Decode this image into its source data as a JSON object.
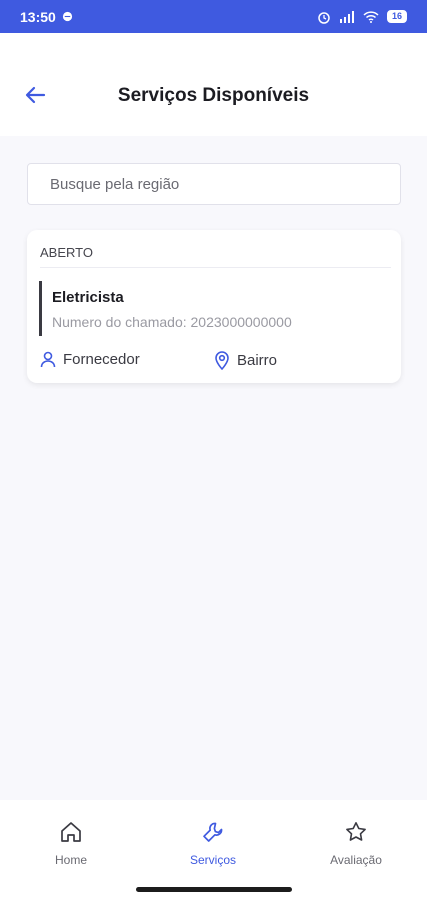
{
  "statusbar": {
    "time": "13:50",
    "battery": "16"
  },
  "header": {
    "title": "Serviços Disponíveis"
  },
  "search": {
    "placeholder": "Busque pela região"
  },
  "card": {
    "status": "ABERTO",
    "service": "Eletricista",
    "number": "Numero do chamado: 2023000000000",
    "provider": "Fornecedor",
    "location": "Bairro"
  },
  "nav": {
    "items": [
      {
        "label": "Home",
        "icon": "home-icon"
      },
      {
        "label": "Serviços",
        "icon": "wrench-icon"
      },
      {
        "label": "Avaliação",
        "icon": "star-icon"
      }
    ]
  },
  "colors": {
    "accent": "#3f5ae0",
    "active_nav": "#3f5ae0",
    "inactive_nav": "#6a6a72"
  }
}
